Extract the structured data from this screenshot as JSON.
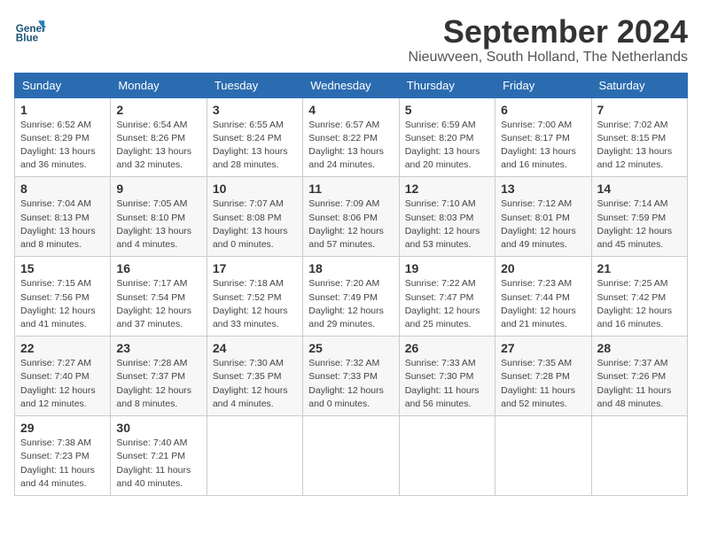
{
  "header": {
    "logo_line1": "General",
    "logo_line2": "Blue",
    "month": "September 2024",
    "location": "Nieuwveen, South Holland, The Netherlands"
  },
  "weekdays": [
    "Sunday",
    "Monday",
    "Tuesday",
    "Wednesday",
    "Thursday",
    "Friday",
    "Saturday"
  ],
  "weeks": [
    [
      {
        "day": "1",
        "detail": "Sunrise: 6:52 AM\nSunset: 8:29 PM\nDaylight: 13 hours\nand 36 minutes."
      },
      {
        "day": "2",
        "detail": "Sunrise: 6:54 AM\nSunset: 8:26 PM\nDaylight: 13 hours\nand 32 minutes."
      },
      {
        "day": "3",
        "detail": "Sunrise: 6:55 AM\nSunset: 8:24 PM\nDaylight: 13 hours\nand 28 minutes."
      },
      {
        "day": "4",
        "detail": "Sunrise: 6:57 AM\nSunset: 8:22 PM\nDaylight: 13 hours\nand 24 minutes."
      },
      {
        "day": "5",
        "detail": "Sunrise: 6:59 AM\nSunset: 8:20 PM\nDaylight: 13 hours\nand 20 minutes."
      },
      {
        "day": "6",
        "detail": "Sunrise: 7:00 AM\nSunset: 8:17 PM\nDaylight: 13 hours\nand 16 minutes."
      },
      {
        "day": "7",
        "detail": "Sunrise: 7:02 AM\nSunset: 8:15 PM\nDaylight: 13 hours\nand 12 minutes."
      }
    ],
    [
      {
        "day": "8",
        "detail": "Sunrise: 7:04 AM\nSunset: 8:13 PM\nDaylight: 13 hours\nand 8 minutes."
      },
      {
        "day": "9",
        "detail": "Sunrise: 7:05 AM\nSunset: 8:10 PM\nDaylight: 13 hours\nand 4 minutes."
      },
      {
        "day": "10",
        "detail": "Sunrise: 7:07 AM\nSunset: 8:08 PM\nDaylight: 13 hours\nand 0 minutes."
      },
      {
        "day": "11",
        "detail": "Sunrise: 7:09 AM\nSunset: 8:06 PM\nDaylight: 12 hours\nand 57 minutes."
      },
      {
        "day": "12",
        "detail": "Sunrise: 7:10 AM\nSunset: 8:03 PM\nDaylight: 12 hours\nand 53 minutes."
      },
      {
        "day": "13",
        "detail": "Sunrise: 7:12 AM\nSunset: 8:01 PM\nDaylight: 12 hours\nand 49 minutes."
      },
      {
        "day": "14",
        "detail": "Sunrise: 7:14 AM\nSunset: 7:59 PM\nDaylight: 12 hours\nand 45 minutes."
      }
    ],
    [
      {
        "day": "15",
        "detail": "Sunrise: 7:15 AM\nSunset: 7:56 PM\nDaylight: 12 hours\nand 41 minutes."
      },
      {
        "day": "16",
        "detail": "Sunrise: 7:17 AM\nSunset: 7:54 PM\nDaylight: 12 hours\nand 37 minutes."
      },
      {
        "day": "17",
        "detail": "Sunrise: 7:18 AM\nSunset: 7:52 PM\nDaylight: 12 hours\nand 33 minutes."
      },
      {
        "day": "18",
        "detail": "Sunrise: 7:20 AM\nSunset: 7:49 PM\nDaylight: 12 hours\nand 29 minutes."
      },
      {
        "day": "19",
        "detail": "Sunrise: 7:22 AM\nSunset: 7:47 PM\nDaylight: 12 hours\nand 25 minutes."
      },
      {
        "day": "20",
        "detail": "Sunrise: 7:23 AM\nSunset: 7:44 PM\nDaylight: 12 hours\nand 21 minutes."
      },
      {
        "day": "21",
        "detail": "Sunrise: 7:25 AM\nSunset: 7:42 PM\nDaylight: 12 hours\nand 16 minutes."
      }
    ],
    [
      {
        "day": "22",
        "detail": "Sunrise: 7:27 AM\nSunset: 7:40 PM\nDaylight: 12 hours\nand 12 minutes."
      },
      {
        "day": "23",
        "detail": "Sunrise: 7:28 AM\nSunset: 7:37 PM\nDaylight: 12 hours\nand 8 minutes."
      },
      {
        "day": "24",
        "detail": "Sunrise: 7:30 AM\nSunset: 7:35 PM\nDaylight: 12 hours\nand 4 minutes."
      },
      {
        "day": "25",
        "detail": "Sunrise: 7:32 AM\nSunset: 7:33 PM\nDaylight: 12 hours\nand 0 minutes."
      },
      {
        "day": "26",
        "detail": "Sunrise: 7:33 AM\nSunset: 7:30 PM\nDaylight: 11 hours\nand 56 minutes."
      },
      {
        "day": "27",
        "detail": "Sunrise: 7:35 AM\nSunset: 7:28 PM\nDaylight: 11 hours\nand 52 minutes."
      },
      {
        "day": "28",
        "detail": "Sunrise: 7:37 AM\nSunset: 7:26 PM\nDaylight: 11 hours\nand 48 minutes."
      }
    ],
    [
      {
        "day": "29",
        "detail": "Sunrise: 7:38 AM\nSunset: 7:23 PM\nDaylight: 11 hours\nand 44 minutes."
      },
      {
        "day": "30",
        "detail": "Sunrise: 7:40 AM\nSunset: 7:21 PM\nDaylight: 11 hours\nand 40 minutes."
      },
      null,
      null,
      null,
      null,
      null
    ]
  ]
}
